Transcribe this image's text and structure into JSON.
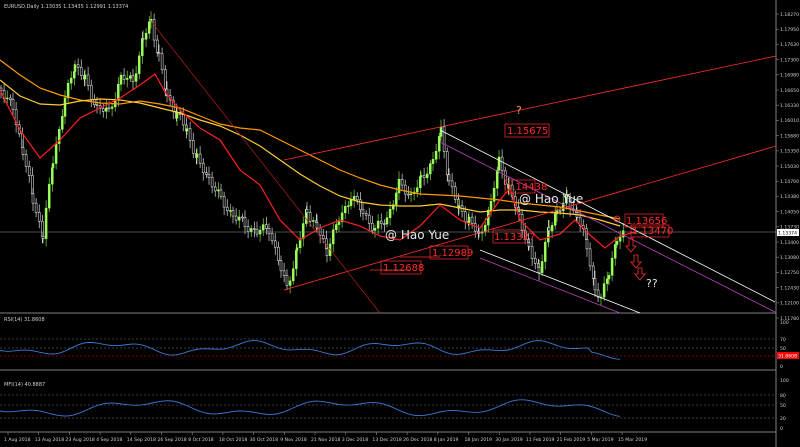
{
  "header": {
    "symbol_line": "EURUSD,Daily   1.13035 1.13435 1.12991 1.13374"
  },
  "rsi_panel": {
    "label": "RSI(14) 31.8608"
  },
  "mfi_panel": {
    "label": "MFI(14) 40.8887"
  },
  "price_axis": {
    "ticks": [
      "1.18270",
      "1.17950",
      "1.17630",
      "1.17300",
      "1.16980",
      "1.16650",
      "1.16330",
      "1.16010",
      "1.15680",
      "1.15350",
      "1.15030",
      "1.14700",
      "1.14380",
      "1.14050",
      "1.13730",
      "1.13400",
      "1.13080",
      "1.12750",
      "1.12430",
      "1.12100",
      "1.11780"
    ],
    "current_price": "1.13374"
  },
  "rsi_axis": {
    "ticks": [
      "100",
      "70",
      "50",
      "30",
      "0"
    ],
    "current": "31.8608"
  },
  "mfi_axis": {
    "ticks": [
      "100",
      "80",
      "50",
      "20",
      "0"
    ]
  },
  "date_axis": {
    "ticks": [
      "1 Aug 2018",
      "13 Aug 2018",
      "23 Aug 2018",
      "4 Sep 2018",
      "14 Sep 2018",
      "26 Sep 2018",
      "8 Oct 2018",
      "18 Oct 2018",
      "30 Oct 2018",
      "9 Nov 2018",
      "21 Nov 2018",
      "3 Dec 2018",
      "13 Dec 2018",
      "26 Dec 2018",
      "8 Jan 2019",
      "18 Jan 2019",
      "30 Jan 2019",
      "11 Feb 2019",
      "21 Feb 2019",
      "5 Mar 2019",
      "15 Mar 2019"
    ]
  },
  "annotations": {
    "price_labels": [
      "1.15675",
      "1.14438",
      "1.13327",
      "1.12989",
      "1.12688",
      "1.13656",
      "1.13470"
    ],
    "watermark": "@ Hao Yue",
    "question_single": "?",
    "question_double": "??"
  },
  "colors": {
    "bull_candle": "#9bff5a",
    "bear_candle": "#ffffff",
    "ma_fast": "#ff2020",
    "ma_mid": "#ffcc33",
    "ma_slow": "#ff9900",
    "channel": "#c040c0",
    "trend_red": "#ff3030",
    "indicator_line": "#3a7bd5",
    "level_red": "#ff0000"
  }
}
